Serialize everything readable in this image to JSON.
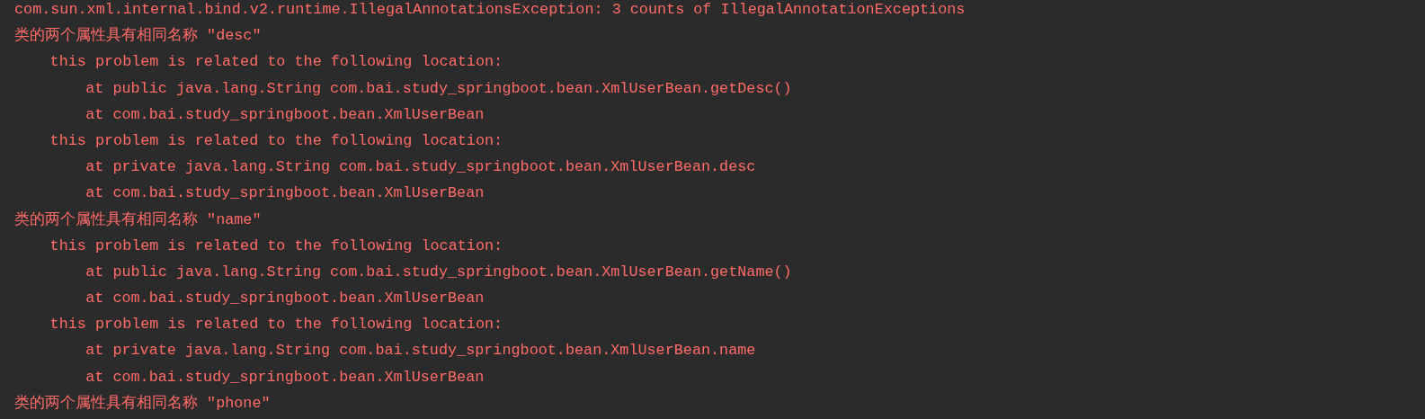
{
  "console": {
    "exception": "com.sun.xml.internal.bind.v2.runtime.IllegalAnnotationsException: 3 counts of IllegalAnnotationExceptions",
    "lines": [
      {
        "text": "类的两个属性具有相同名称 \"desc\"",
        "children": [
          {
            "text": "this problem is related to the following location:",
            "children": [
              {
                "text": "at public java.lang.String com.bai.study_springboot.bean.XmlUserBean.getDesc()"
              },
              {
                "text": "at com.bai.study_springboot.bean.XmlUserBean"
              }
            ]
          },
          {
            "text": "this problem is related to the following location:",
            "children": [
              {
                "text": "at private java.lang.String com.bai.study_springboot.bean.XmlUserBean.desc"
              },
              {
                "text": "at com.bai.study_springboot.bean.XmlUserBean"
              }
            ]
          }
        ]
      },
      {
        "text": "类的两个属性具有相同名称 \"name\"",
        "children": [
          {
            "text": "this problem is related to the following location:",
            "children": [
              {
                "text": "at public java.lang.String com.bai.study_springboot.bean.XmlUserBean.getName()"
              },
              {
                "text": "at com.bai.study_springboot.bean.XmlUserBean"
              }
            ]
          },
          {
            "text": "this problem is related to the following location:",
            "children": [
              {
                "text": "at private java.lang.String com.bai.study_springboot.bean.XmlUserBean.name"
              },
              {
                "text": "at com.bai.study_springboot.bean.XmlUserBean"
              }
            ]
          }
        ]
      },
      {
        "text": "类的两个属性具有相同名称 \"phone\""
      }
    ]
  }
}
